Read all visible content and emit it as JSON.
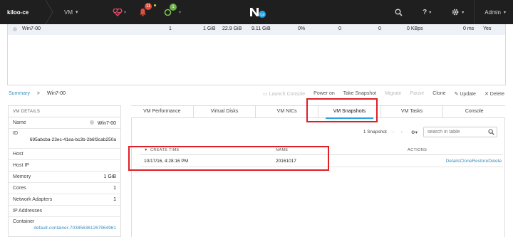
{
  "topbar": {
    "brand": "kiloo-ce",
    "vm_menu": "VM",
    "alerts_count": "11",
    "tasks_count": "1",
    "user": "Admin"
  },
  "vm_row": {
    "name": "Win7-00",
    "hosts": "1",
    "memory": "1 GiB",
    "storage_provisioned": "22.9 GiB",
    "storage_used": "9.11 GiB",
    "cpu": "0%",
    "iops": "0",
    "latency": "0",
    "bandwidth": "0 KBps",
    "ms": "0 ms",
    "flag": "Yes"
  },
  "breadcrumb": {
    "root": "Summary",
    "separator": ">",
    "current": "Win7-00"
  },
  "actions": {
    "launch_console": "Launch Console",
    "power_on": "Power on",
    "take_snapshot": "Take Snapshot",
    "migrate": "Migrate",
    "pause": "Pause",
    "clone": "Clone",
    "update": "Update",
    "delete": "Delete"
  },
  "details": {
    "title": "VM DETAILS",
    "rows": [
      {
        "label": "Name",
        "value": "Win7-00"
      },
      {
        "label": "ID",
        "value": "695abcba-23ec-41ea-bc3b-2b6f3cab250a"
      },
      {
        "label": "Host",
        "value": ""
      },
      {
        "label": "Host IP",
        "value": ""
      },
      {
        "label": "Memory",
        "value": "1 GiB"
      },
      {
        "label": "Cores",
        "value": "1"
      },
      {
        "label": "Network Adapters",
        "value": "1"
      },
      {
        "label": "IP Addresses",
        "value": ""
      },
      {
        "label": "Container",
        "value": "default-container-703856361267964961"
      }
    ]
  },
  "tabs": [
    "VM Performance",
    "Virtual Disks",
    "VM NICs",
    "VM Snapshots",
    "VM Tasks",
    "Console"
  ],
  "snapshots": {
    "count_label": "1 Snapshot",
    "search_placeholder": "search in table",
    "columns": {
      "create_time": "CREATE TIME",
      "name": "NAME",
      "actions": "ACTIONS"
    },
    "rows": [
      {
        "create_time": "10/17/16, 4:28:16 PM",
        "name": "20161017"
      }
    ],
    "row_actions": [
      "Details",
      "Clone",
      "Restore",
      "Delete"
    ]
  },
  "colors": {
    "accent": "#29a3e6",
    "highlight": "#e01e26",
    "link": "#3a8fc4",
    "nav_bg": "#1f1f1f"
  }
}
